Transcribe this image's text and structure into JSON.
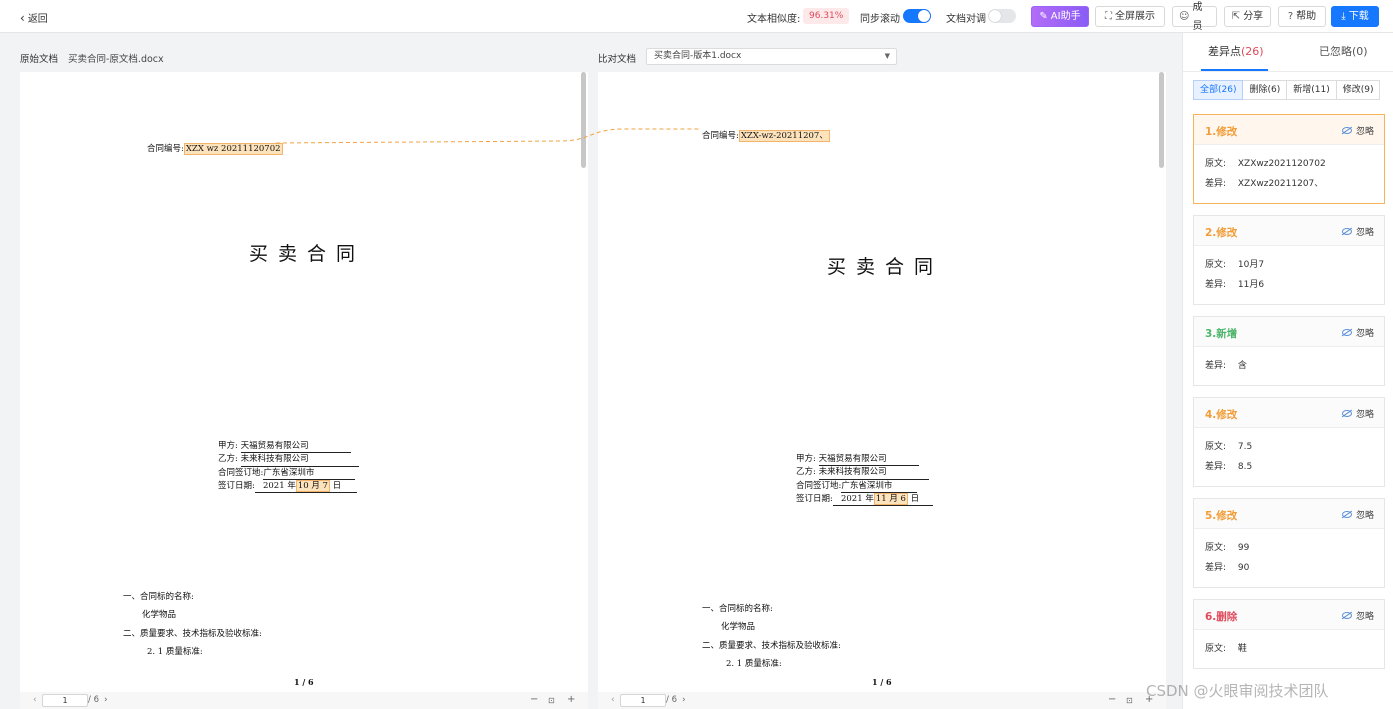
{
  "topbar": {
    "back_label": "返回",
    "similarity_label": "文本相似度:",
    "similarity_value": "96.31%",
    "sync_scroll_label": "同步滚动",
    "sync_scroll_on": true,
    "doc_align_label": "文档对调",
    "doc_align_on": false,
    "ai_label": "AI助手",
    "fullscreen_label": "全屏展示",
    "members_label": "成员",
    "share_label": "分享",
    "help_label": "帮助",
    "download_label": "下载"
  },
  "left_doc": {
    "label": "原始文档",
    "name": "买卖合同-原文档.docx",
    "contract_no_label": "合同编号:",
    "contract_no": "XZX wz 20211120702",
    "title": "买卖合同",
    "party_a_label": "甲方:",
    "party_a": "天福贸易有限公司",
    "party_b_label": "乙方:",
    "party_b": "未来科技有限公司",
    "sign_place_label": "合同签订地:",
    "sign_place": "广东省深圳市",
    "sign_date_label": "签订日期:",
    "sign_date_year": "2021 年",
    "sign_date_hl": "10 月 7",
    "sign_date_day": "日",
    "sec1": "一、合同标的名称:",
    "sec1_item": "化学物品",
    "sec2": "二、质量要求、技术指标及验收标准:",
    "sec2_item": "2. 1 质量标准:",
    "page_indicator": "1 / 6",
    "page_input": "1",
    "page_total": "/ 6"
  },
  "right_doc": {
    "label": "比对文档",
    "name": "买卖合同-版本1.docx",
    "contract_no_label": "合同编号:",
    "contract_no": "XZX-wz-20211207、",
    "title": "买卖合同",
    "party_a_label": "甲方:",
    "party_a": "天福贸易有限公司",
    "party_b_label": "乙方:",
    "party_b": "未来科技有限公司",
    "sign_place_label": "合同签订地:",
    "sign_place": "广东省深圳市",
    "sign_date_label": "签订日期:",
    "sign_date_year": "2021 年",
    "sign_date_hl": "11 月 6",
    "sign_date_day": "日",
    "sec1": "一、合同标的名称:",
    "sec1_item": "化学物品",
    "sec2": "二、质量要求、技术指标及验收标准:",
    "sec2_item": "2. 1 质量标准:",
    "page_indicator": "1 / 6",
    "page_input": "1",
    "page_total": "/ 6"
  },
  "sidebar": {
    "tab_diff_label": "差异点",
    "tab_diff_count": "(26)",
    "tab_ignored_label": "已忽略(0)",
    "filters": [
      "全部(26)",
      "删除(6)",
      "新增(11)",
      "修改(9)"
    ],
    "ignore_label": "忽略",
    "original_label": "原文:",
    "diff_label": "差异:",
    "cards": [
      {
        "title": "1.修改",
        "type": "mod",
        "original": "XZXwz2021120702",
        "diff": "XZXwz20211207、"
      },
      {
        "title": "2.修改",
        "type": "mod",
        "original": "10月7",
        "diff": "11月6"
      },
      {
        "title": "3.新增",
        "type": "add",
        "diff": "含"
      },
      {
        "title": "4.修改",
        "type": "mod",
        "original": "7.5",
        "diff": "8.5"
      },
      {
        "title": "5.修改",
        "type": "mod",
        "original": "99",
        "diff": "90"
      },
      {
        "title": "6.删除",
        "type": "del",
        "original": "鞋"
      }
    ]
  },
  "watermark": "CSDN @火眼审阅技术团队",
  "colors": {
    "accent": "#1677ff",
    "modify": "#f29d38",
    "add": "#4bb56a",
    "delete": "#e04a5b",
    "highlight": "#fde3bc"
  }
}
